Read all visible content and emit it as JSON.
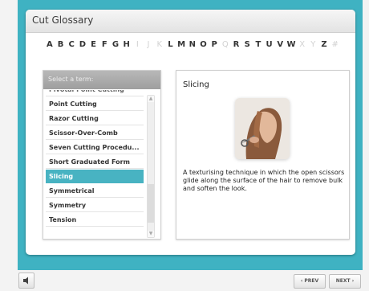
{
  "window": {
    "title": "Cut Glossary"
  },
  "alphabet": [
    {
      "letter": "A",
      "enabled": true
    },
    {
      "letter": "B",
      "enabled": true
    },
    {
      "letter": "C",
      "enabled": true
    },
    {
      "letter": "D",
      "enabled": true
    },
    {
      "letter": "E",
      "enabled": true
    },
    {
      "letter": "F",
      "enabled": true
    },
    {
      "letter": "G",
      "enabled": true
    },
    {
      "letter": "H",
      "enabled": true
    },
    {
      "letter": "I",
      "enabled": false
    },
    {
      "letter": "J",
      "enabled": false
    },
    {
      "letter": "K",
      "enabled": false
    },
    {
      "letter": "L",
      "enabled": true
    },
    {
      "letter": "M",
      "enabled": true
    },
    {
      "letter": "N",
      "enabled": true
    },
    {
      "letter": "O",
      "enabled": true
    },
    {
      "letter": "P",
      "enabled": true
    },
    {
      "letter": "Q",
      "enabled": false
    },
    {
      "letter": "R",
      "enabled": true
    },
    {
      "letter": "S",
      "enabled": true
    },
    {
      "letter": "T",
      "enabled": true
    },
    {
      "letter": "U",
      "enabled": true
    },
    {
      "letter": "V",
      "enabled": true
    },
    {
      "letter": "W",
      "enabled": true
    },
    {
      "letter": "X",
      "enabled": false
    },
    {
      "letter": "Y",
      "enabled": false
    },
    {
      "letter": "Z",
      "enabled": true
    },
    {
      "letter": "#",
      "enabled": false
    }
  ],
  "list": {
    "header": "Select a term:",
    "items": [
      {
        "label": "Pivotal Point Cutting",
        "selected": false,
        "partial": true
      },
      {
        "label": "Point Cutting",
        "selected": false,
        "partial": false
      },
      {
        "label": "Razor Cutting",
        "selected": false,
        "partial": false
      },
      {
        "label": "Scissor-Over-Comb",
        "selected": false,
        "partial": false
      },
      {
        "label": "Seven Cutting Procedu...",
        "selected": false,
        "partial": false
      },
      {
        "label": "Short Graduated Form",
        "selected": false,
        "partial": false
      },
      {
        "label": "Slicing",
        "selected": true,
        "partial": false
      },
      {
        "label": "Symmetrical",
        "selected": false,
        "partial": false
      },
      {
        "label": "Symmetry",
        "selected": false,
        "partial": false
      },
      {
        "label": "Tension",
        "selected": false,
        "partial": false
      }
    ]
  },
  "term": {
    "title": "Slicing",
    "description": "A texturising technique in which the open scissors glide along the surface of the hair to remove bulk and soften the look."
  },
  "nav": {
    "prev_label": "PREV",
    "next_label": "NEXT"
  },
  "colors": {
    "frame": "#3fb2c2",
    "selected": "#48b3c2",
    "disabled_letter": "#d2d2d2"
  },
  "icons": {
    "audio": "speaker-icon",
    "prev": "chevron-left-icon",
    "next": "chevron-right-icon"
  }
}
